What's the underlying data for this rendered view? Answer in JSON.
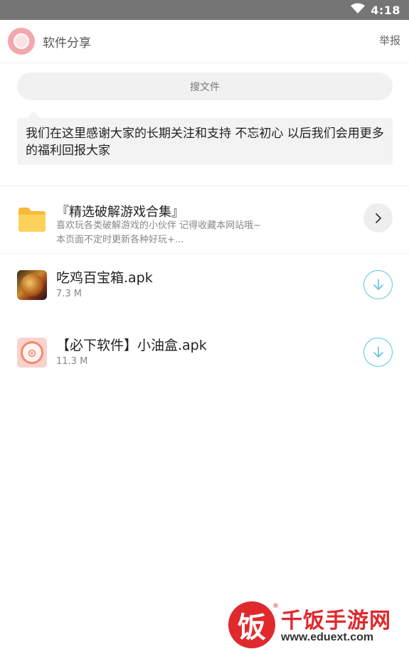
{
  "status_bar": {
    "time": "4:18"
  },
  "header": {
    "title": "软件分享",
    "report": "举报"
  },
  "search": {
    "placeholder": "搜文件"
  },
  "notice": {
    "text": "我们在这里感谢大家的长期关注和支持 不忘初心 以后我们会用更多的福利回报大家"
  },
  "folder": {
    "title": "『精选破解游戏合集』",
    "description": "喜欢玩各类破解游戏的小伙伴 记得收藏本网站哦~本页面不定时更新各种好玩+..."
  },
  "files": [
    {
      "name": "吃鸡百宝箱.apk",
      "size": "7.3 M",
      "icon": "pubg-app-icon"
    },
    {
      "name": "【必下软件】小油盒.apk",
      "size": "11.3 M",
      "icon": "xiaoyouhe-app-icon"
    }
  ],
  "watermark": {
    "logo_char": "饭",
    "name": "千饭手游网",
    "url": "www.eduext.com",
    "reg": "®"
  },
  "colors": {
    "status_bar": "#757575",
    "accent_download": "#5fc4d8",
    "watermark_red": "#e0292d"
  }
}
